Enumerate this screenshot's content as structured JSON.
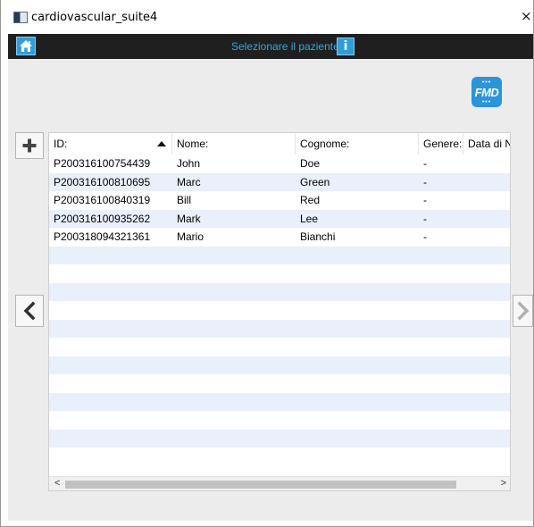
{
  "window": {
    "title": "cardiovascular_suite4",
    "close_glyph": "×"
  },
  "topbar": {
    "title": "Selezionare il paziente",
    "home_icon": "home-icon",
    "info_label": "i"
  },
  "logo": {
    "text": "FMD"
  },
  "table": {
    "columns": [
      "ID:",
      "Nome:",
      "Cognome:",
      "Genere:",
      "Data di N"
    ],
    "sort_column": "ID:",
    "sort_direction": "ascending",
    "rows": [
      {
        "id": "P200316100754439",
        "nome": "John",
        "cognome": "Doe",
        "genere": "-",
        "data": ""
      },
      {
        "id": "P200316100810695",
        "nome": "Marc",
        "cognome": "Green",
        "genere": "-",
        "data": ""
      },
      {
        "id": "P200316100840319",
        "nome": "Bill",
        "cognome": "Red",
        "genere": "-",
        "data": ""
      },
      {
        "id": "P200316100935262",
        "nome": "Mark",
        "cognome": "Lee",
        "genere": "-",
        "data": ""
      },
      {
        "id": "P200318094321361",
        "nome": "Mario",
        "cognome": "Bianchi",
        "genere": "-",
        "data": ""
      }
    ],
    "empty_rows": 12
  },
  "scrollbar": {
    "left_glyph": "<",
    "right_glyph": ">"
  },
  "colors": {
    "accent": "#2f9ed8",
    "topbar_bg": "#1f1f1f",
    "row_stripe": "#e8f0fb"
  }
}
